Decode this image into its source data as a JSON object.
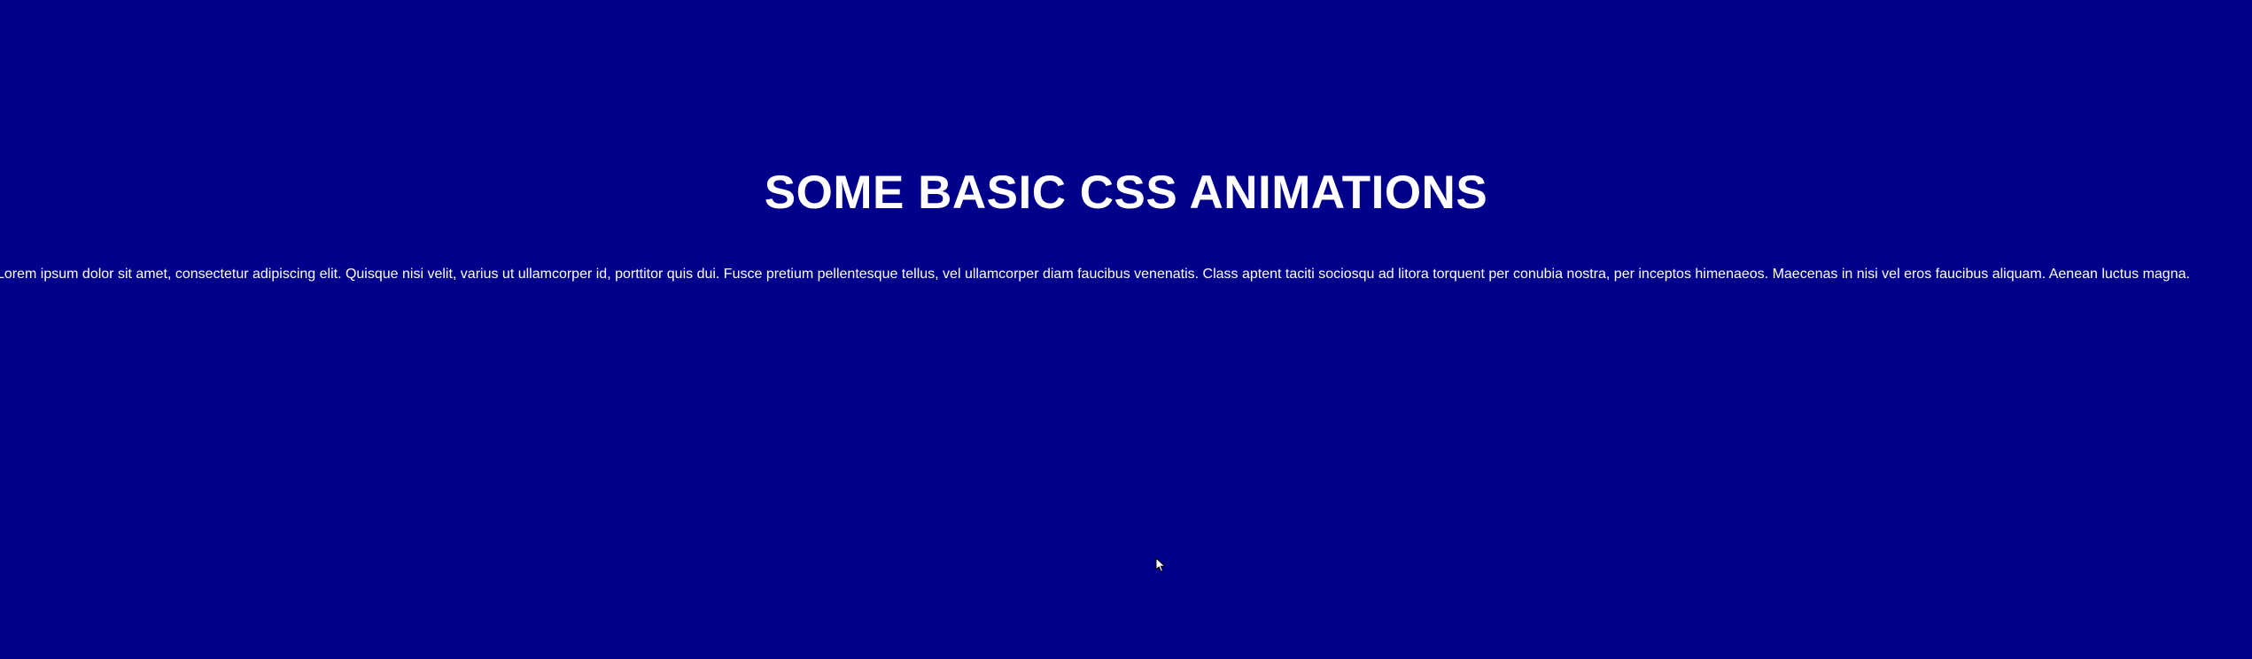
{
  "page": {
    "background_color": "#00008b",
    "text_color": "#ffffff",
    "title": "SOME BASIC CSS ANIMATIONS",
    "paragraph": "Lorem ipsum dolor sit amet, consectetur adipiscing elit. Quisque nisi velit, varius ut ullamcorper id, porttitor quis dui. Fusce pretium pellentesque tellus, vel ullamcorper diam faucibus venenatis. Class aptent taciti sociosqu ad litora torquent per conubia nostra, per inceptos himenaeos. Maecenas in nisi vel eros faucibus aliquam. Aenean luctus magna."
  },
  "cursor": {
    "icon": "arrow-cursor-icon"
  }
}
